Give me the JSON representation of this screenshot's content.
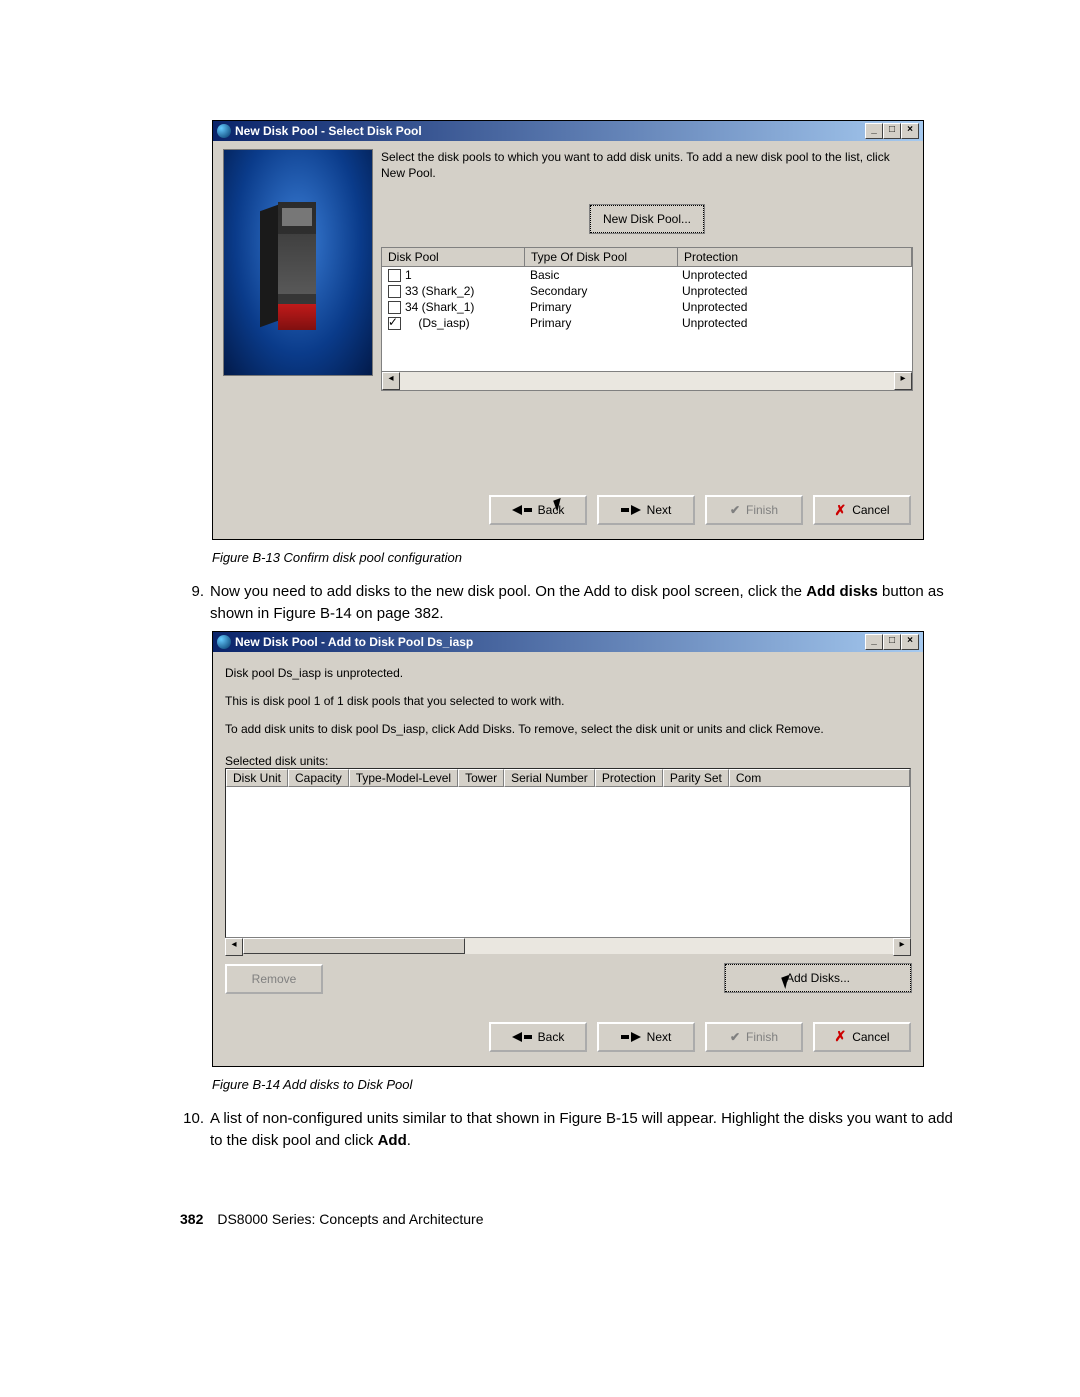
{
  "figure1": {
    "title": "New Disk Pool - Select Disk Pool",
    "instruction": "Select the disk pools to which you want to add disk units.  To add a new disk pool to the list, click New Pool.",
    "new_pool_btn": "New Disk Pool...",
    "headers": {
      "c1": "Disk Pool",
      "c2": "Type Of Disk Pool",
      "c3": "Protection"
    },
    "rows": [
      {
        "checked": false,
        "name": "1",
        "type": "Basic",
        "prot": "Unprotected"
      },
      {
        "checked": false,
        "name": "33 (Shark_2)",
        "type": "Secondary",
        "prot": "Unprotected"
      },
      {
        "checked": false,
        "name": "34 (Shark_1)",
        "type": "Primary",
        "prot": "Unprotected"
      },
      {
        "checked": true,
        "name": "    (Ds_iasp)",
        "type": "Primary",
        "prot": "Unprotected"
      }
    ],
    "btns": {
      "back": "Back",
      "next": "Next",
      "finish": "Finish",
      "cancel": "Cancel"
    },
    "caption": "Figure B-13   Confirm disk pool configuration"
  },
  "para9": {
    "num": "9.",
    "t1": "Now you need to add disks to the new disk pool. On the Add to disk pool screen, click the ",
    "bold": "Add disks",
    "t2": " button as shown in Figure B-14 on page 382."
  },
  "figure2": {
    "title": "New Disk Pool - Add to Disk Pool Ds_iasp",
    "line1": "Disk pool Ds_iasp is unprotected.",
    "line2": "This is disk pool 1 of 1 disk pools that you selected to work with.",
    "line3": "To add disk units to disk pool Ds_iasp, click Add Disks. To remove, select the disk unit or units and click Remove.",
    "sel_label": "Selected disk units:",
    "cols": [
      "Disk Unit",
      "Capacity",
      "Type-Model-Level",
      "Tower",
      "Serial Number",
      "Protection",
      "Parity Set",
      "Com"
    ],
    "remove_btn": "Remove",
    "add_btn": "Add Disks...",
    "btns": {
      "back": "Back",
      "next": "Next",
      "finish": "Finish",
      "cancel": "Cancel"
    },
    "caption": "Figure B-14   Add disks to Disk Pool"
  },
  "para10": {
    "num": "10.",
    "t1": "A list of non-configured units similar to that shown in Figure B-15 will appear. Highlight the disks you want to add to the disk pool and click ",
    "bold": "Add",
    "t2": "."
  },
  "footer": {
    "page": "382",
    "title": "DS8000 Series: Concepts and Architecture"
  }
}
